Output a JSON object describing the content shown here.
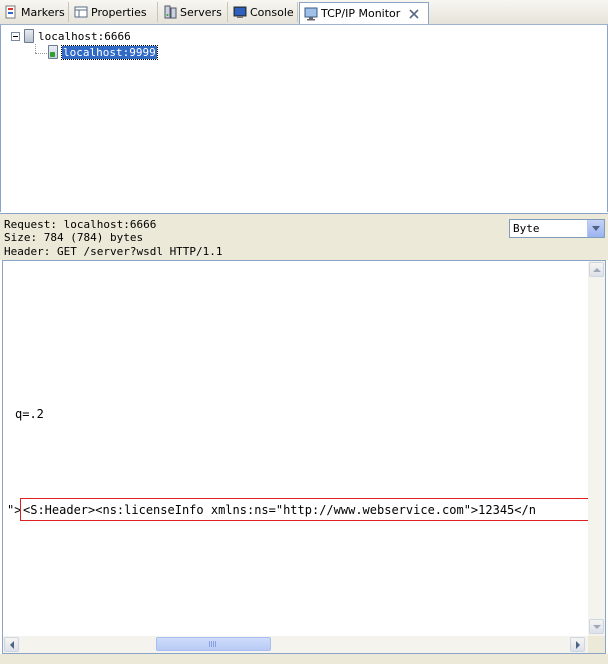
{
  "tabs": [
    {
      "label": "Markers",
      "icon": "markers-icon"
    },
    {
      "label": "Properties",
      "icon": "properties-icon"
    },
    {
      "label": "Servers",
      "icon": "servers-icon"
    },
    {
      "label": "Console",
      "icon": "console-icon"
    },
    {
      "label": "TCP/IP Monitor",
      "icon": "tcpip-monitor-icon",
      "active": true,
      "close_icon": "close-icon"
    }
  ],
  "tree": {
    "root": {
      "label": "localhost:6666",
      "icon": "server-icon",
      "expanded": true
    },
    "child": {
      "label": "localhost:9999",
      "icon": "request-icon",
      "selected": true
    }
  },
  "info": {
    "request": "Request: localhost:6666",
    "size": "Size: 784 (784) bytes",
    "header": "Header: GET /server?wsdl HTTP/1.1",
    "view_select": "Byte"
  },
  "content": {
    "line1": "q=.2",
    "line2_prefix": "\">",
    "line2_highlight": "<S:Header><ns:licenseInfo xmlns:ns=\"http://www.webservice.com\">12345</n"
  },
  "colors": {
    "highlight_box": "#e02020",
    "selection": "#316ac5"
  }
}
